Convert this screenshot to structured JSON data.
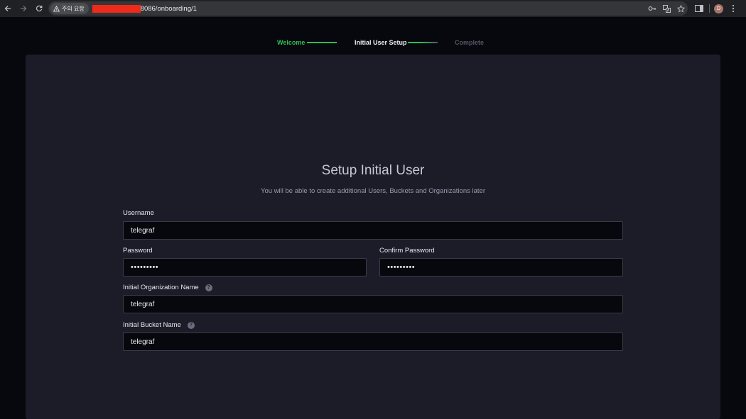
{
  "browser": {
    "security_chip": "주의 요함",
    "url_suffix": "8086/onboarding/1",
    "profile_initial": "D",
    "redaction_color": "#ee2a1a"
  },
  "icons": {
    "back": "arrow-left-icon",
    "forward": "arrow-right-icon",
    "reload": "reload-icon",
    "warning": "warning-triangle-icon",
    "key": "key-icon",
    "translate": "translate-icon",
    "bookmark": "star-icon",
    "side_panel": "side-panel-icon",
    "menu": "kebab-menu-icon",
    "help": "question-icon"
  },
  "stepper": {
    "steps": [
      {
        "label": "Welcome",
        "status": "done"
      },
      {
        "label": "Initial User Setup",
        "status": "current"
      },
      {
        "label": "Complete",
        "status": "todo"
      }
    ],
    "colors": {
      "done": "#34bb55",
      "current": "#f1f1f3",
      "todo": "#545667"
    }
  },
  "form": {
    "title": "Setup Initial User",
    "subtitle": "You will be able to create additional Users, Buckets and Organizations later",
    "username": {
      "label": "Username",
      "value": "telegraf"
    },
    "password": {
      "label": "Password",
      "value": "•••••••••"
    },
    "confirm_password": {
      "label": "Confirm Password",
      "value": "•••••••••"
    },
    "org_name": {
      "label": "Initial Organization Name",
      "value": "telegraf"
    },
    "bucket_name": {
      "label": "Initial Bucket Name",
      "value": "telegraf"
    }
  }
}
